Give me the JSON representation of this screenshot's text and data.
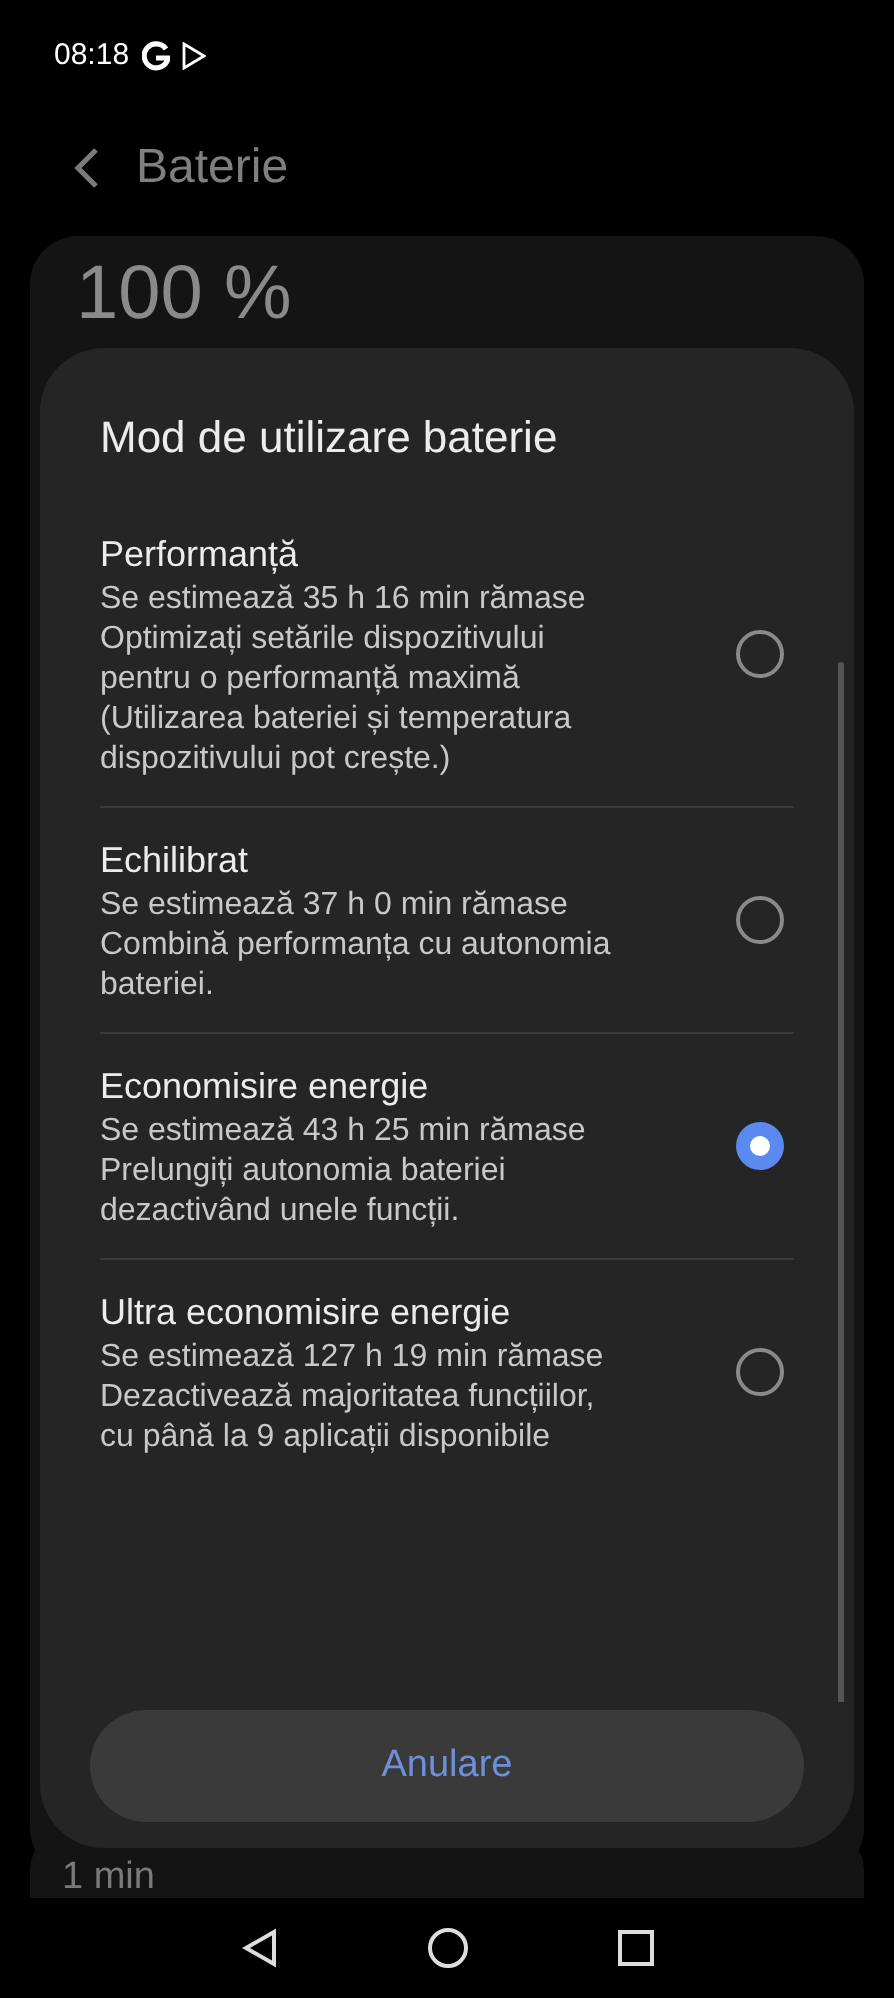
{
  "status_bar": {
    "time": "08:18"
  },
  "header": {
    "title": "Baterie"
  },
  "background": {
    "battery_level": "100 %",
    "bottom_text": "1 min"
  },
  "dialog": {
    "title": "Mod de utilizare baterie",
    "options": [
      {
        "title": "Performanță",
        "estimate": "Se estimează 35 h 16 min rămase",
        "description": "Optimizați setările dispozitivului pentru o performanță maximă (Utilizarea bateriei și temperatura dispozitivului pot crește.)",
        "selected": false
      },
      {
        "title": "Echilibrat",
        "estimate": "Se estimează 37 h 0 min rămase",
        "description": "Combină performanța cu autonomia bateriei.",
        "selected": false
      },
      {
        "title": "Economisire energie",
        "estimate": "Se estimează 43 h 25 min rămase",
        "description": "Prelungiți autonomia bateriei dezactivând unele funcții.",
        "selected": true
      },
      {
        "title": "Ultra economisire energie",
        "estimate": "Se estimează 127 h 19 min rămase",
        "description": "Dezactivează majoritatea funcțiilor, cu până la 9 aplicații disponibile",
        "selected": false
      }
    ],
    "cancel_button": "Anulare"
  }
}
